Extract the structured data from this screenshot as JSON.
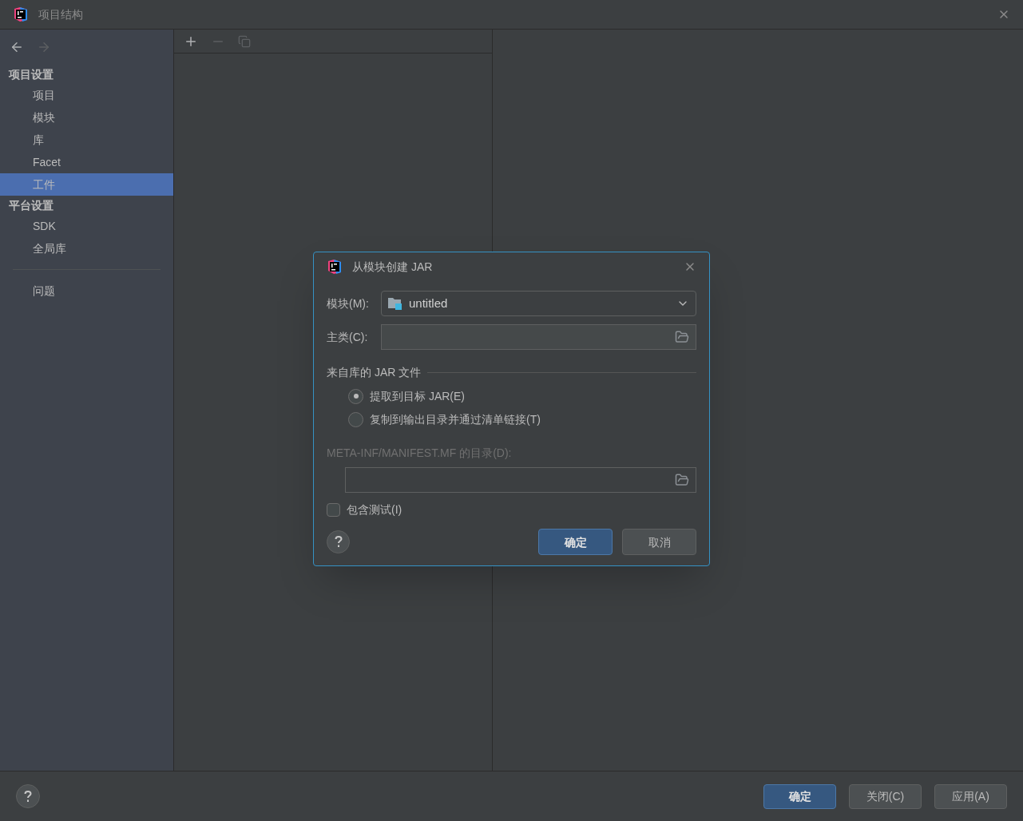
{
  "window": {
    "title": "项目结构"
  },
  "sidebar": {
    "sections": [
      {
        "title": "项目设置",
        "items": [
          {
            "label": "项目",
            "selected": false
          },
          {
            "label": "模块",
            "selected": false
          },
          {
            "label": "库",
            "selected": false
          },
          {
            "label": "Facet",
            "selected": false
          },
          {
            "label": "工件",
            "selected": true
          }
        ]
      },
      {
        "title": "平台设置",
        "items": [
          {
            "label": "SDK",
            "selected": false
          },
          {
            "label": "全局库",
            "selected": false
          }
        ]
      }
    ],
    "extra_items": [
      {
        "label": "问题",
        "selected": false
      }
    ]
  },
  "dialog": {
    "title": "从模块创建 JAR",
    "module": {
      "label": "模块(M):",
      "value": "untitled"
    },
    "main_class": {
      "label": "主类(C):"
    },
    "group_title": "来自库的 JAR 文件",
    "radios": [
      {
        "label": "提取到目标 JAR(E)",
        "selected": true
      },
      {
        "label": "复制到输出目录并通过清单链接(T)",
        "selected": false
      }
    ],
    "manifest": {
      "label": "META-INF/MANIFEST.MF 的目录(D):",
      "disabled": true
    },
    "include_tests": {
      "label": "包含测试(I)",
      "checked": false
    },
    "buttons": [
      {
        "label": "确定",
        "primary": true
      },
      {
        "label": "取消",
        "primary": false
      }
    ]
  },
  "footer": {
    "buttons": [
      {
        "label": "确定",
        "primary": true
      },
      {
        "label": "关闭(C)",
        "primary": false
      },
      {
        "label": "应用(A)",
        "primary": false
      }
    ]
  }
}
